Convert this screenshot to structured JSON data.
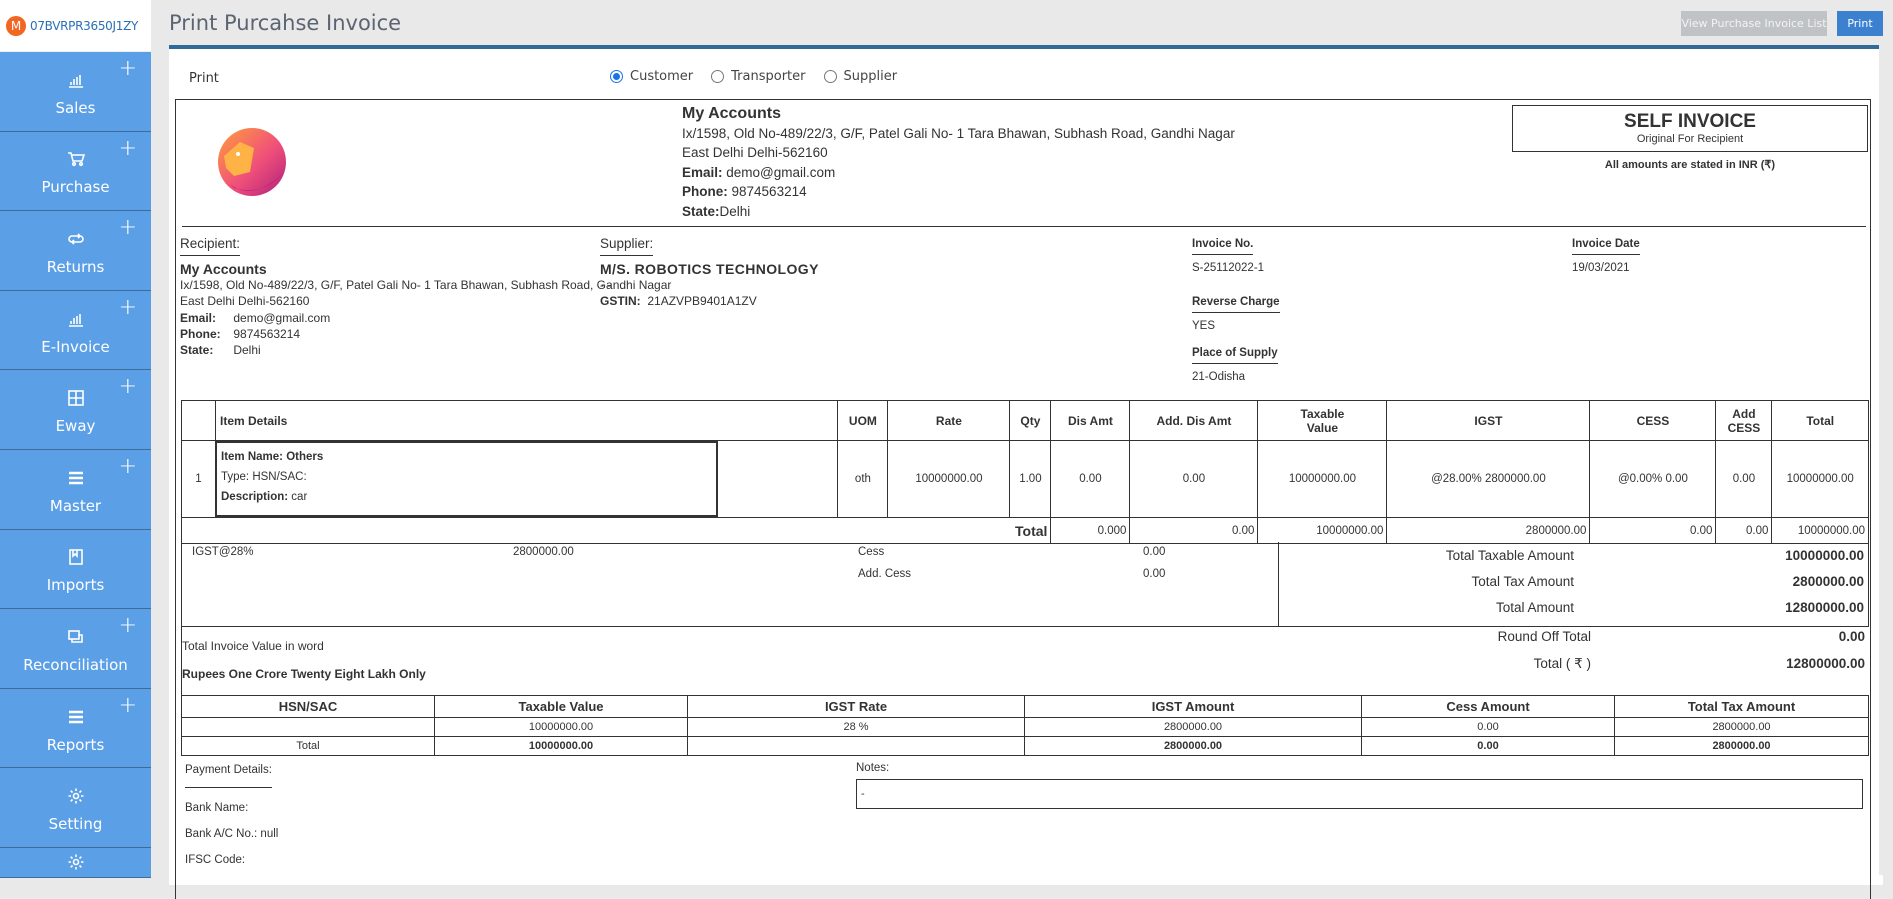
{
  "user": {
    "initial": "M",
    "gstin": "07BVRPR3650J1ZY"
  },
  "sidebar": {
    "items": [
      {
        "label": "Sales",
        "icon": "bar-chart-icon",
        "has_add": true
      },
      {
        "label": "Purchase",
        "icon": "cart-icon",
        "has_add": true
      },
      {
        "label": "Returns",
        "icon": "refresh-icon",
        "has_add": true
      },
      {
        "label": "E-Invoice",
        "icon": "bar-chart-icon",
        "has_add": true
      },
      {
        "label": "Eway",
        "icon": "grid-icon",
        "has_add": true
      },
      {
        "label": "Master",
        "icon": "menu-icon",
        "has_add": true
      },
      {
        "label": "Imports",
        "icon": "book-icon",
        "has_add": false
      },
      {
        "label": "Reconciliation",
        "icon": "copy-icon",
        "has_add": true
      },
      {
        "label": "Reports",
        "icon": "menu-icon",
        "has_add": true
      },
      {
        "label": "Setting",
        "icon": "gear-icon",
        "has_add": false
      }
    ],
    "add_glyph": "+"
  },
  "header": {
    "title": "Print Purcahse Invoice",
    "view_list_label": "View Purchase Invoice List",
    "print_label": "Print"
  },
  "print_options": {
    "label": "Print",
    "options": [
      "Customer",
      "Transporter",
      "Supplier"
    ],
    "selected": "Customer"
  },
  "company": {
    "name": "My Accounts",
    "address1": "Ix/1598, Old No-489/22/3, G/F, Patel Gali No- 1 Tara Bhawan, Subhash Road, Gandhi Nagar",
    "address2": "East Delhi Delhi-562160",
    "email_label": "Email:",
    "email": "demo@gmail.com",
    "phone_label": "Phone:",
    "phone": "9874563214",
    "state_label": "State:",
    "state": "Delhi"
  },
  "invoice_type": {
    "title": "SELF INVOICE",
    "subtitle": "Original For Recipient",
    "currency_note": "All amounts are stated in INR (₹)"
  },
  "recipient": {
    "heading": "Recipient:",
    "name": "My Accounts",
    "address1": "Ix/1598, Old No-489/22/3, G/F, Patel Gali No- 1 Tara Bhawan, Subhash Road, Gandhi Nagar",
    "address2": "East Delhi Delhi-562160",
    "email_label": "Email:",
    "email": "demo@gmail.com",
    "phone_label": "Phone:",
    "phone": "9874563214",
    "state_label": "State:",
    "state": "Delhi"
  },
  "supplier": {
    "heading": "Supplier:",
    "name": "M/S. ROBOTICS TECHNOLOGY",
    "address": "- -",
    "gstin_label": "GSTIN:",
    "gstin": "21AZVPB9401A1ZV"
  },
  "meta": {
    "invoice_no_label": "Invoice No.",
    "invoice_no": "S-25112022-1",
    "invoice_date_label": "Invoice Date",
    "invoice_date": "19/03/2021",
    "reverse_charge_label": "Reverse Charge",
    "reverse_charge": "YES",
    "place_of_supply_label": "Place of Supply",
    "place_of_supply": "21-Odisha"
  },
  "items_table": {
    "headers": [
      "",
      "Item Details",
      "UOM",
      "Rate",
      "Qty",
      "Dis Amt",
      "Add. Dis Amt",
      "Taxable Value",
      "IGST",
      "CESS",
      "Add CESS",
      "Total"
    ],
    "rows": [
      {
        "sno": "1",
        "item_name_label": "Item Name:",
        "item_name": "Others",
        "type": "Type: HSN/SAC:",
        "description_label": "Description:",
        "description": "car",
        "uom": "oth",
        "rate": "10000000.00",
        "qty": "1.00",
        "dis_amt": "0.00",
        "add_dis_amt": "0.00",
        "taxable_value": "10000000.00",
        "igst": "@28.00% 2800000.00",
        "cess": "@0.00% 0.00",
        "add_cess": "0.00",
        "total": "10000000.00"
      }
    ],
    "total_row": {
      "label": "Total",
      "dis_amt": "0.000",
      "add_dis_amt": "0.00",
      "taxable_value": "10000000.00",
      "igst": "2800000.00",
      "cess": "0.00",
      "add_cess": "0.00",
      "total": "10000000.00"
    }
  },
  "tax_summary": {
    "igst_label": "IGST@28%",
    "igst_value": "2800000.00",
    "cess_label": "Cess",
    "cess_value": "0.00",
    "add_cess_label": "Add. Cess",
    "add_cess_value": "0.00"
  },
  "totals": {
    "total_taxable_label": "Total Taxable Amount",
    "total_taxable": "10000000.00",
    "total_tax_label": "Total Tax Amount",
    "total_tax": "2800000.00",
    "total_amount_label": "Total Amount",
    "total_amount": "12800000.00",
    "round_off_label": "Round Off Total",
    "round_off": "0.00",
    "grand_total_label": "Total ( ₹ )",
    "grand_total": "12800000.00"
  },
  "amount_words": {
    "label": "Total Invoice Value in word",
    "value": "Rupees One Crore Twenty Eight Lakh Only"
  },
  "hsn_table": {
    "headers": [
      "HSN/SAC",
      "Taxable Value",
      "IGST Rate",
      "IGST Amount",
      "Cess Amount",
      "Total Tax Amount"
    ],
    "rows": [
      [
        "",
        "10000000.00",
        "28 %",
        "2800000.00",
        "0.00",
        "2800000.00"
      ]
    ],
    "total_row": [
      "Total",
      "10000000.00",
      "",
      "2800000.00",
      "0.00",
      "2800000.00"
    ]
  },
  "payment": {
    "heading": "Payment Details:",
    "bank_name": "Bank Name:",
    "bank_ac": "Bank A/C No.: null",
    "ifsc": "IFSC Code:"
  },
  "notes": {
    "heading": "Notes:",
    "value": "-"
  }
}
